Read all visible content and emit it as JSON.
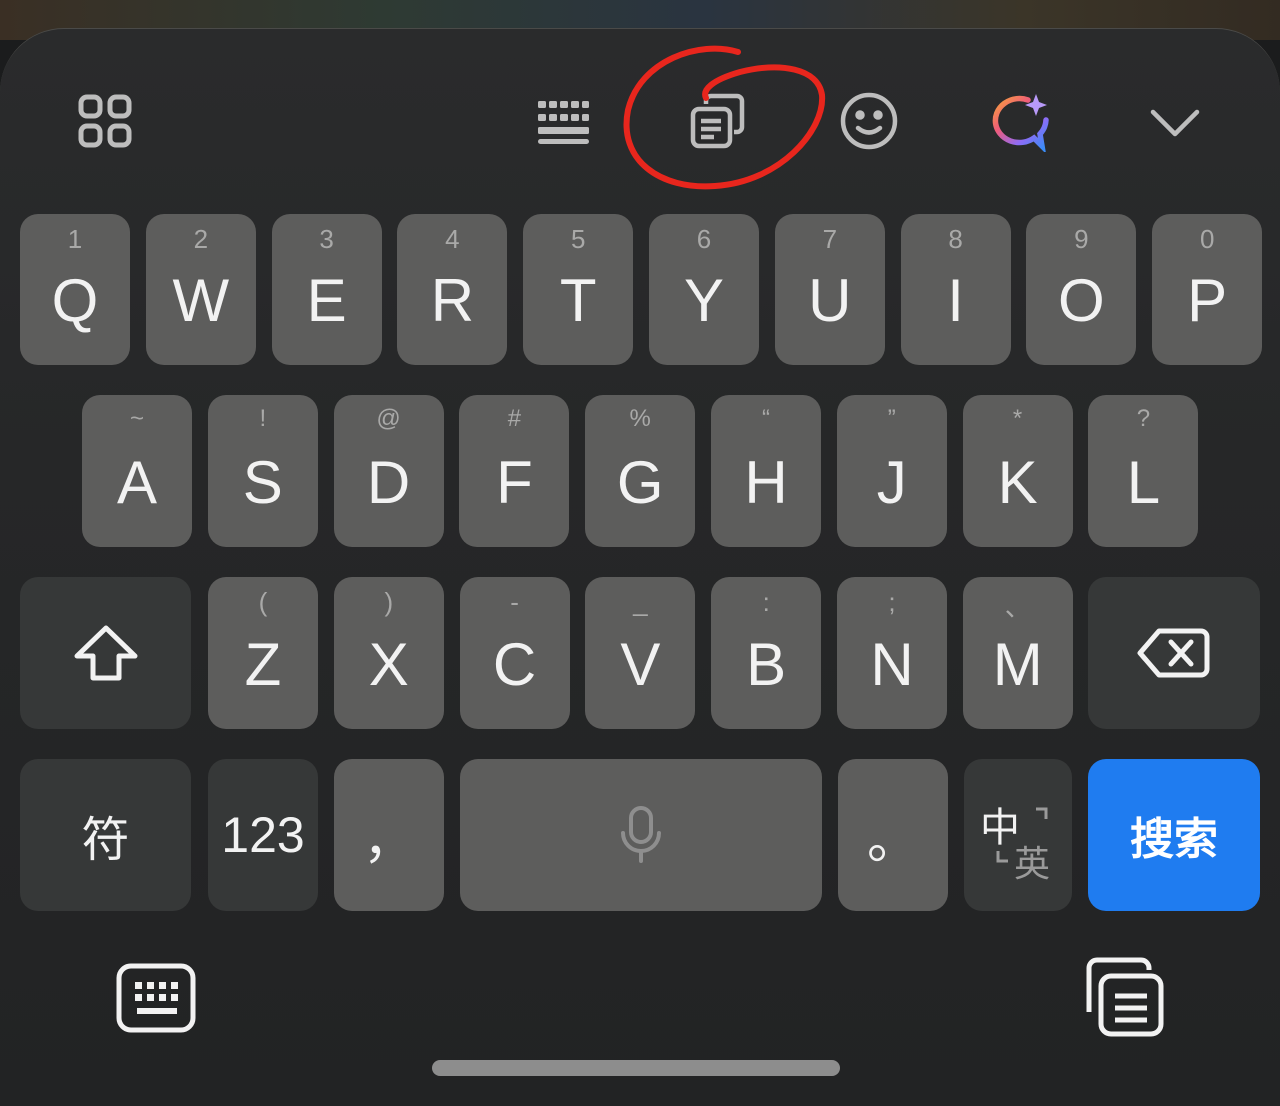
{
  "toolbar": {
    "icons": [
      {
        "name": "apps-grid-icon"
      },
      {
        "name": "keyboard-layout-icon"
      },
      {
        "name": "clipboard-icon"
      },
      {
        "name": "emoji-icon"
      },
      {
        "name": "ai-assistant-icon"
      },
      {
        "name": "chevron-down-icon"
      }
    ]
  },
  "rows": {
    "row1": [
      {
        "letter": "Q",
        "sub": "1"
      },
      {
        "letter": "W",
        "sub": "2"
      },
      {
        "letter": "E",
        "sub": "3"
      },
      {
        "letter": "R",
        "sub": "4"
      },
      {
        "letter": "T",
        "sub": "5"
      },
      {
        "letter": "Y",
        "sub": "6"
      },
      {
        "letter": "U",
        "sub": "7"
      },
      {
        "letter": "I",
        "sub": "8"
      },
      {
        "letter": "O",
        "sub": "9"
      },
      {
        "letter": "P",
        "sub": "0"
      }
    ],
    "row2": [
      {
        "letter": "A",
        "sub": "~"
      },
      {
        "letter": "S",
        "sub": "!"
      },
      {
        "letter": "D",
        "sub": "@"
      },
      {
        "letter": "F",
        "sub": "#"
      },
      {
        "letter": "G",
        "sub": "%"
      },
      {
        "letter": "H",
        "sub": "“"
      },
      {
        "letter": "J",
        "sub": "”"
      },
      {
        "letter": "K",
        "sub": "*"
      },
      {
        "letter": "L",
        "sub": "?"
      }
    ],
    "row3": [
      {
        "letter": "Z",
        "sub": "("
      },
      {
        "letter": "X",
        "sub": ")"
      },
      {
        "letter": "C",
        "sub": "-"
      },
      {
        "letter": "V",
        "sub": "_"
      },
      {
        "letter": "B",
        "sub": ":"
      },
      {
        "letter": "N",
        "sub": ";"
      },
      {
        "letter": "M",
        "sub": "、"
      }
    ]
  },
  "bottom_row": {
    "symbols": "符",
    "numbers": "123",
    "comma": "，",
    "period": "。",
    "lang_zh": "中",
    "lang_en": "英",
    "search": "搜索"
  },
  "colors": {
    "accent": "#1f7cf0",
    "key": "#5d5d5c",
    "key_dark": "#363838",
    "annotation": "#e8261d"
  }
}
